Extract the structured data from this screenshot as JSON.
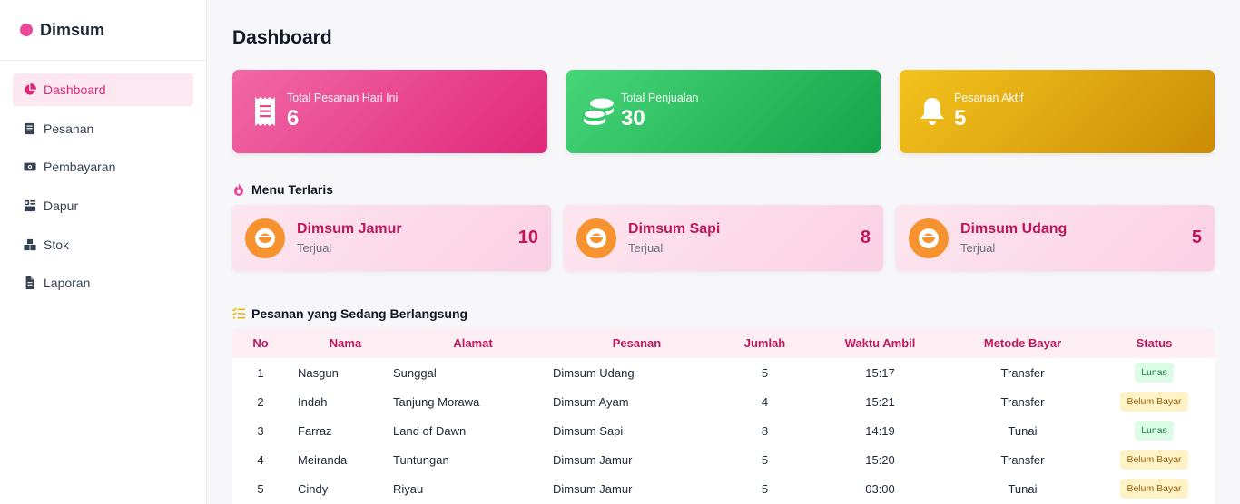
{
  "brand": {
    "name": "Dimsum"
  },
  "sidebar": {
    "items": [
      {
        "label": "Dashboard",
        "icon": "pie-chart-icon",
        "active": true
      },
      {
        "label": "Pesanan",
        "icon": "document-icon"
      },
      {
        "label": "Pembayaran",
        "icon": "money-icon"
      },
      {
        "label": "Dapur",
        "icon": "kitchen-icon"
      },
      {
        "label": "Stok",
        "icon": "boxes-icon"
      },
      {
        "label": "Laporan",
        "icon": "file-icon"
      }
    ]
  },
  "page": {
    "title": "Dashboard"
  },
  "stats": [
    {
      "label": "Total Pesanan Hari Ini",
      "value": "6",
      "icon": "receipt-icon",
      "color": "#e0287b"
    },
    {
      "label": "Total Penjualan",
      "value": "30",
      "icon": "coins-icon",
      "color": "#16a34a"
    },
    {
      "label": "Pesanan Aktif",
      "value": "5",
      "icon": "bell-icon",
      "color": "#cc8c06"
    }
  ],
  "best_menu": {
    "title": "Menu Terlaris",
    "icon": "fire-icon",
    "items": [
      {
        "name": "Dimsum Jamur",
        "sub": "Terjual",
        "count": "10",
        "icon": "bowl-icon"
      },
      {
        "name": "Dimsum Sapi",
        "sub": "Terjual",
        "count": "8",
        "icon": "bowl-icon"
      },
      {
        "name": "Dimsum Udang",
        "sub": "Terjual",
        "count": "5",
        "icon": "bowl-icon"
      }
    ]
  },
  "orders": {
    "title": "Pesanan yang Sedang Berlangsung",
    "icon": "list-check-icon",
    "columns": [
      "No",
      "Nama",
      "Alamat",
      "Pesanan",
      "Jumlah",
      "Waktu Ambil",
      "Metode Bayar",
      "Status"
    ],
    "rows": [
      {
        "no": "1",
        "nama": "Nasgun",
        "alamat": "Sunggal",
        "pesanan": "Dimsum Udang",
        "jumlah": "5",
        "waktu": "15:17",
        "metode": "Transfer",
        "status": "Lunas"
      },
      {
        "no": "2",
        "nama": "Indah",
        "alamat": "Tanjung Morawa",
        "pesanan": "Dimsum Ayam",
        "jumlah": "4",
        "waktu": "15:21",
        "metode": "Transfer",
        "status": "Belum Bayar"
      },
      {
        "no": "3",
        "nama": "Farraz",
        "alamat": "Land of Dawn",
        "pesanan": "Dimsum Sapi",
        "jumlah": "8",
        "waktu": "14:19",
        "metode": "Tunai",
        "status": "Lunas"
      },
      {
        "no": "4",
        "nama": "Meiranda",
        "alamat": "Tuntungan",
        "pesanan": "Dimsum Jamur",
        "jumlah": "5",
        "waktu": "15:20",
        "metode": "Transfer",
        "status": "Belum Bayar"
      },
      {
        "no": "5",
        "nama": "Cindy",
        "alamat": "Riyau",
        "pesanan": "Dimsum Jamur",
        "jumlah": "5",
        "waktu": "03:00",
        "metode": "Tunai",
        "status": "Belum Bayar"
      }
    ]
  },
  "colors": {
    "accent": "#ec4899",
    "accent_dark": "#be185d",
    "lunas_bg": "#dcfce7",
    "belum_bg": "#fef3c7"
  }
}
